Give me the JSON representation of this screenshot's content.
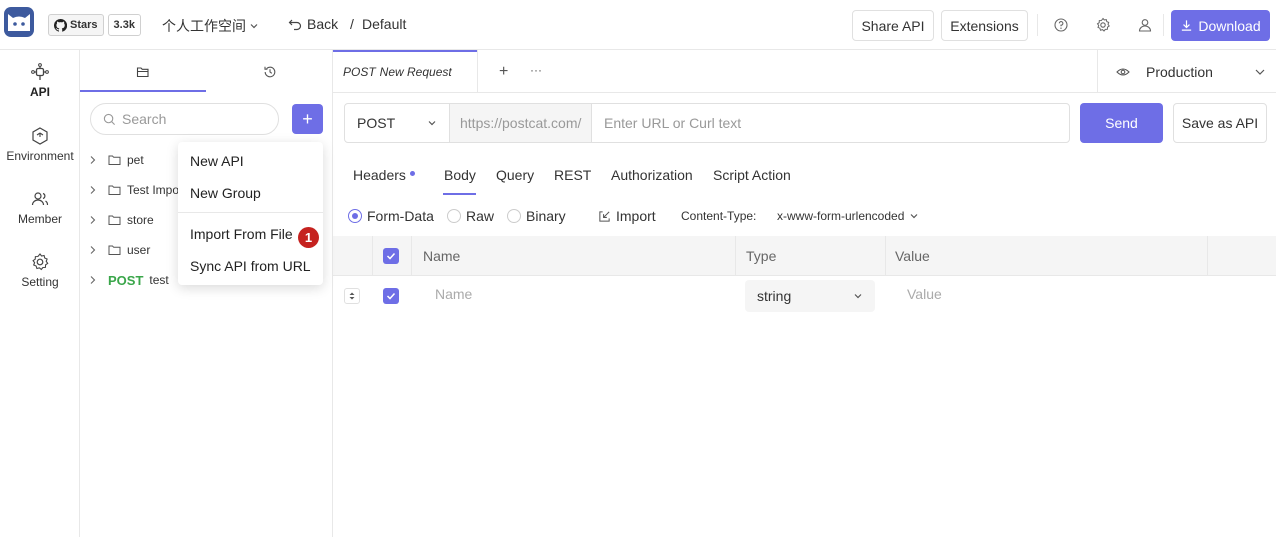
{
  "header": {
    "stars_label": "Stars",
    "stars_count": "3.3k",
    "workspace": "个人工作空间",
    "back_label": "Back",
    "breadcrumb_sep": "/",
    "breadcrumb": "Default",
    "share_api": "Share API",
    "extensions": "Extensions",
    "download": "Download"
  },
  "rail": {
    "items": [
      {
        "label": "API",
        "icon": "api-icon"
      },
      {
        "label": "Environment",
        "icon": "environment-icon"
      },
      {
        "label": "Member",
        "icon": "member-icon"
      },
      {
        "label": "Setting",
        "icon": "setting-icon"
      }
    ]
  },
  "sidebar": {
    "search_placeholder": "Search",
    "add_label": "+",
    "tree": [
      {
        "label": "pet",
        "type": "folder"
      },
      {
        "label": "Test Impo",
        "type": "folder"
      },
      {
        "label": "store",
        "type": "folder"
      },
      {
        "label": "user",
        "type": "folder"
      },
      {
        "label": "test",
        "type": "api",
        "method": "POST"
      }
    ]
  },
  "menu": {
    "items": [
      "New API",
      "New Group",
      "Import From File",
      "Sync API from URL"
    ],
    "badge": "1"
  },
  "request_tab": {
    "method": "POST",
    "name": "New Request",
    "add": "+",
    "more": "···"
  },
  "environment": "Production",
  "url": {
    "method": "POST",
    "prefix": "https://postcat.com/",
    "placeholder": "Enter URL or Curl text",
    "send": "Send",
    "save": "Save as API"
  },
  "param_tabs": [
    "Headers",
    "Body",
    "Query",
    "REST",
    "Authorization",
    "Script Action"
  ],
  "body": {
    "modes": [
      "Form-Data",
      "Raw",
      "Binary"
    ],
    "selected_mode": "Form-Data",
    "import": "Import",
    "content_type_label": "Content-Type:",
    "content_type": "x-www-form-urlencoded"
  },
  "table": {
    "headers": [
      "Name",
      "Type",
      "Value"
    ],
    "row": {
      "name_placeholder": "Name",
      "type": "string",
      "value_placeholder": "Value"
    }
  },
  "colors": {
    "accent": "#6e6ee6",
    "post": "#3aa64a",
    "badge": "#c5221f"
  }
}
